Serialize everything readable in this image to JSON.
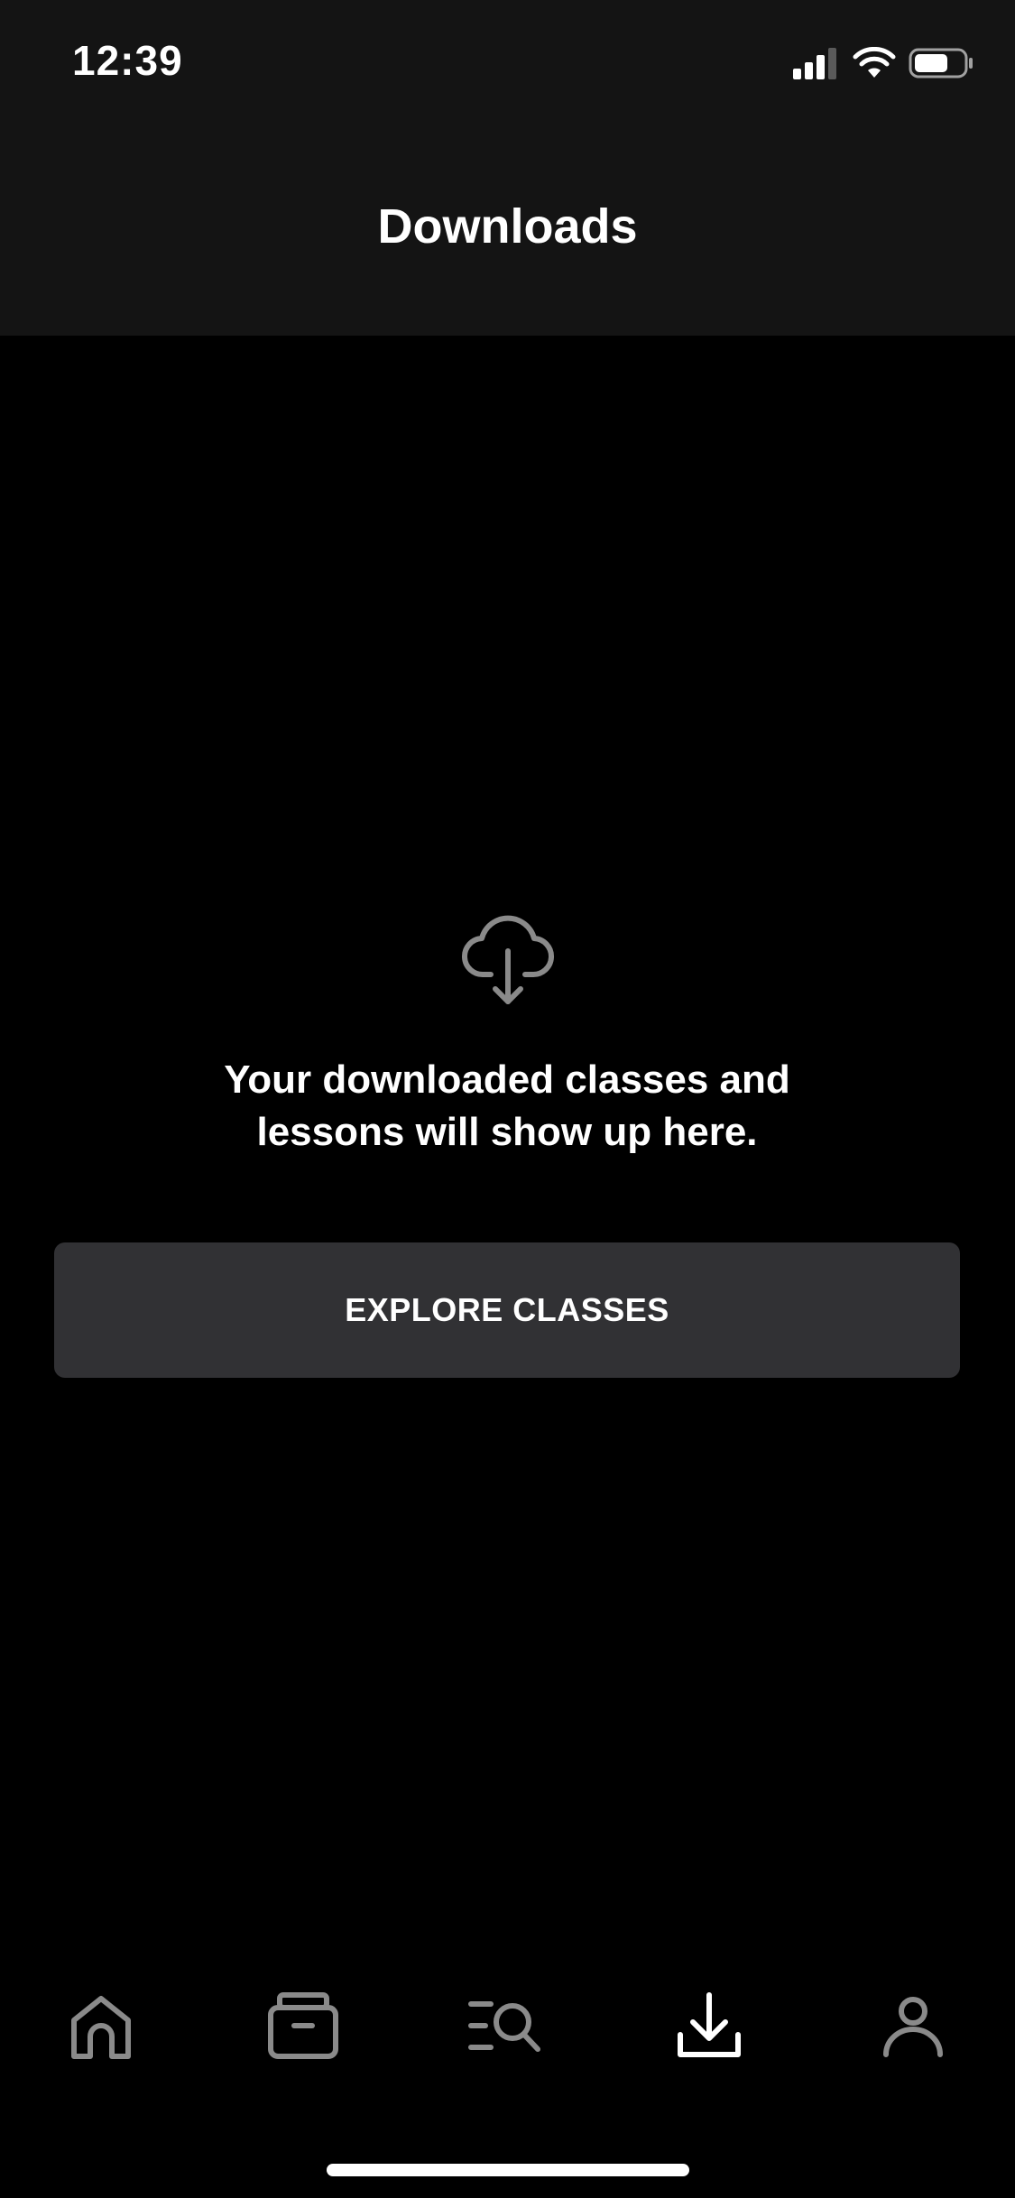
{
  "status_bar": {
    "time": "12:39",
    "icons": [
      "cellular-signal-icon",
      "wifi-icon",
      "battery-icon"
    ],
    "battery_level": 0.7
  },
  "header": {
    "title": "Downloads"
  },
  "empty_state": {
    "icon": "cloud-download-icon",
    "message_line1": "Your downloaded classes and",
    "message_line2": "lessons will show up here.",
    "button_label": "EXPLORE CLASSES"
  },
  "tab_bar": {
    "items": [
      {
        "icon": "home-icon",
        "active": false
      },
      {
        "icon": "archive-box-icon",
        "active": false
      },
      {
        "icon": "search-list-icon",
        "active": false
      },
      {
        "icon": "download-icon",
        "active": true
      },
      {
        "icon": "profile-icon",
        "active": false
      }
    ]
  },
  "colors": {
    "background": "#000000",
    "top_bar": "#141414",
    "button": "#313134",
    "active_icon": "#ffffff",
    "inactive_icon": "#8a8a8a"
  }
}
